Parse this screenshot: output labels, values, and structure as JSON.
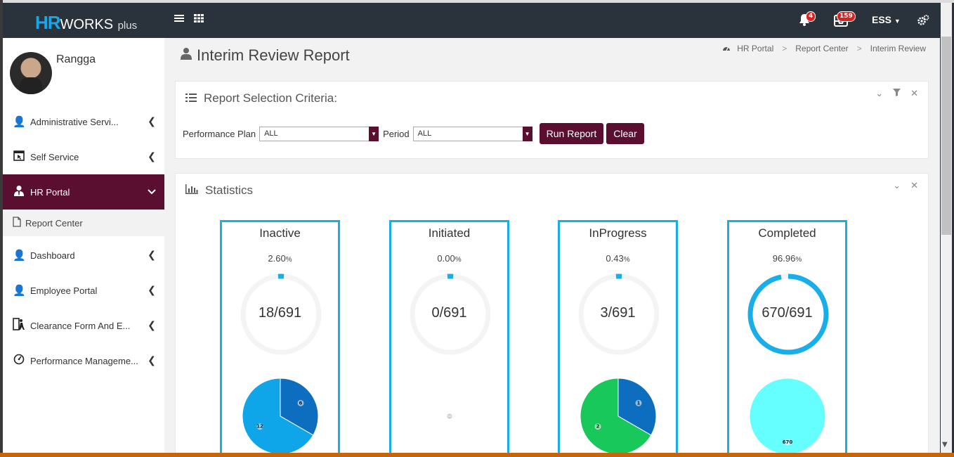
{
  "header": {
    "logo_hr": "HR",
    "logo_works": "WORKS",
    "logo_plus": "plus",
    "menu_icon": "hamburger-icon",
    "apps_icon": "grid-icon",
    "notifications_count": "4",
    "messages_count": "159",
    "role": "ESS"
  },
  "user": {
    "name": "Rangga"
  },
  "sidebar": {
    "items": [
      {
        "label": "Administrative Servi...",
        "icon": "user-icon"
      },
      {
        "label": "Self Service",
        "icon": "window-cursor-icon"
      },
      {
        "label": "HR Portal",
        "icon": "user-tie-icon"
      },
      {
        "label": "Dashboard",
        "icon": "user-icon"
      },
      {
        "label": "Employee Portal",
        "icon": "user-icon"
      },
      {
        "label": "Clearance Form And E...",
        "icon": "exit-icon"
      },
      {
        "label": "Performance Manageme...",
        "icon": "gauge-icon"
      }
    ],
    "sub_item": {
      "label": "Report Center",
      "icon": "document-icon"
    }
  },
  "page": {
    "title": "Interim Review Report",
    "breadcrumb": [
      "HR Portal",
      "Report Center",
      "Interim Review"
    ]
  },
  "criteria": {
    "title": "Report Selection Criteria:",
    "plan_label": "Performance Plan",
    "plan_value": "ALL",
    "period_label": "Period",
    "period_value": "ALL",
    "run_label": "Run Report",
    "clear_label": "Clear"
  },
  "statistics": {
    "title": "Statistics",
    "accent": "#18aee9",
    "cards": [
      {
        "title": "Inactive",
        "pct": "2.60",
        "unit": "%",
        "value": "18/691",
        "fraction": 0.026,
        "pie": [
          {
            "value": 6,
            "label": "6",
            "color": "#0d6ebf"
          },
          {
            "value": 0,
            "label": "0",
            "color": "#e0e0e0"
          },
          {
            "value": 12,
            "label": "12",
            "color": "#0ea6e8"
          }
        ]
      },
      {
        "title": "Initiated",
        "pct": "0.00",
        "unit": "%",
        "value": "0/691",
        "fraction": 0.0,
        "pie": [
          {
            "value": 0,
            "label": "0",
            "color": "#cccccc"
          }
        ]
      },
      {
        "title": "InProgress",
        "pct": "0.43",
        "unit": "%",
        "value": "3/691",
        "fraction": 0.0043,
        "pie": [
          {
            "value": 1,
            "label": "1",
            "color": "#0d6ebf"
          },
          {
            "value": 0,
            "label": "0",
            "color": "#e0e0e0"
          },
          {
            "value": 2,
            "label": "2",
            "color": "#18c85a"
          }
        ]
      },
      {
        "title": "Completed",
        "pct": "96.96",
        "unit": "%",
        "value": "670/691",
        "fraction": 0.9696,
        "pie": [
          {
            "value": 0,
            "label": "0",
            "color": "#e0e0e0"
          },
          {
            "value": 670,
            "label": "670",
            "color": "#66ffff"
          }
        ]
      }
    ]
  }
}
